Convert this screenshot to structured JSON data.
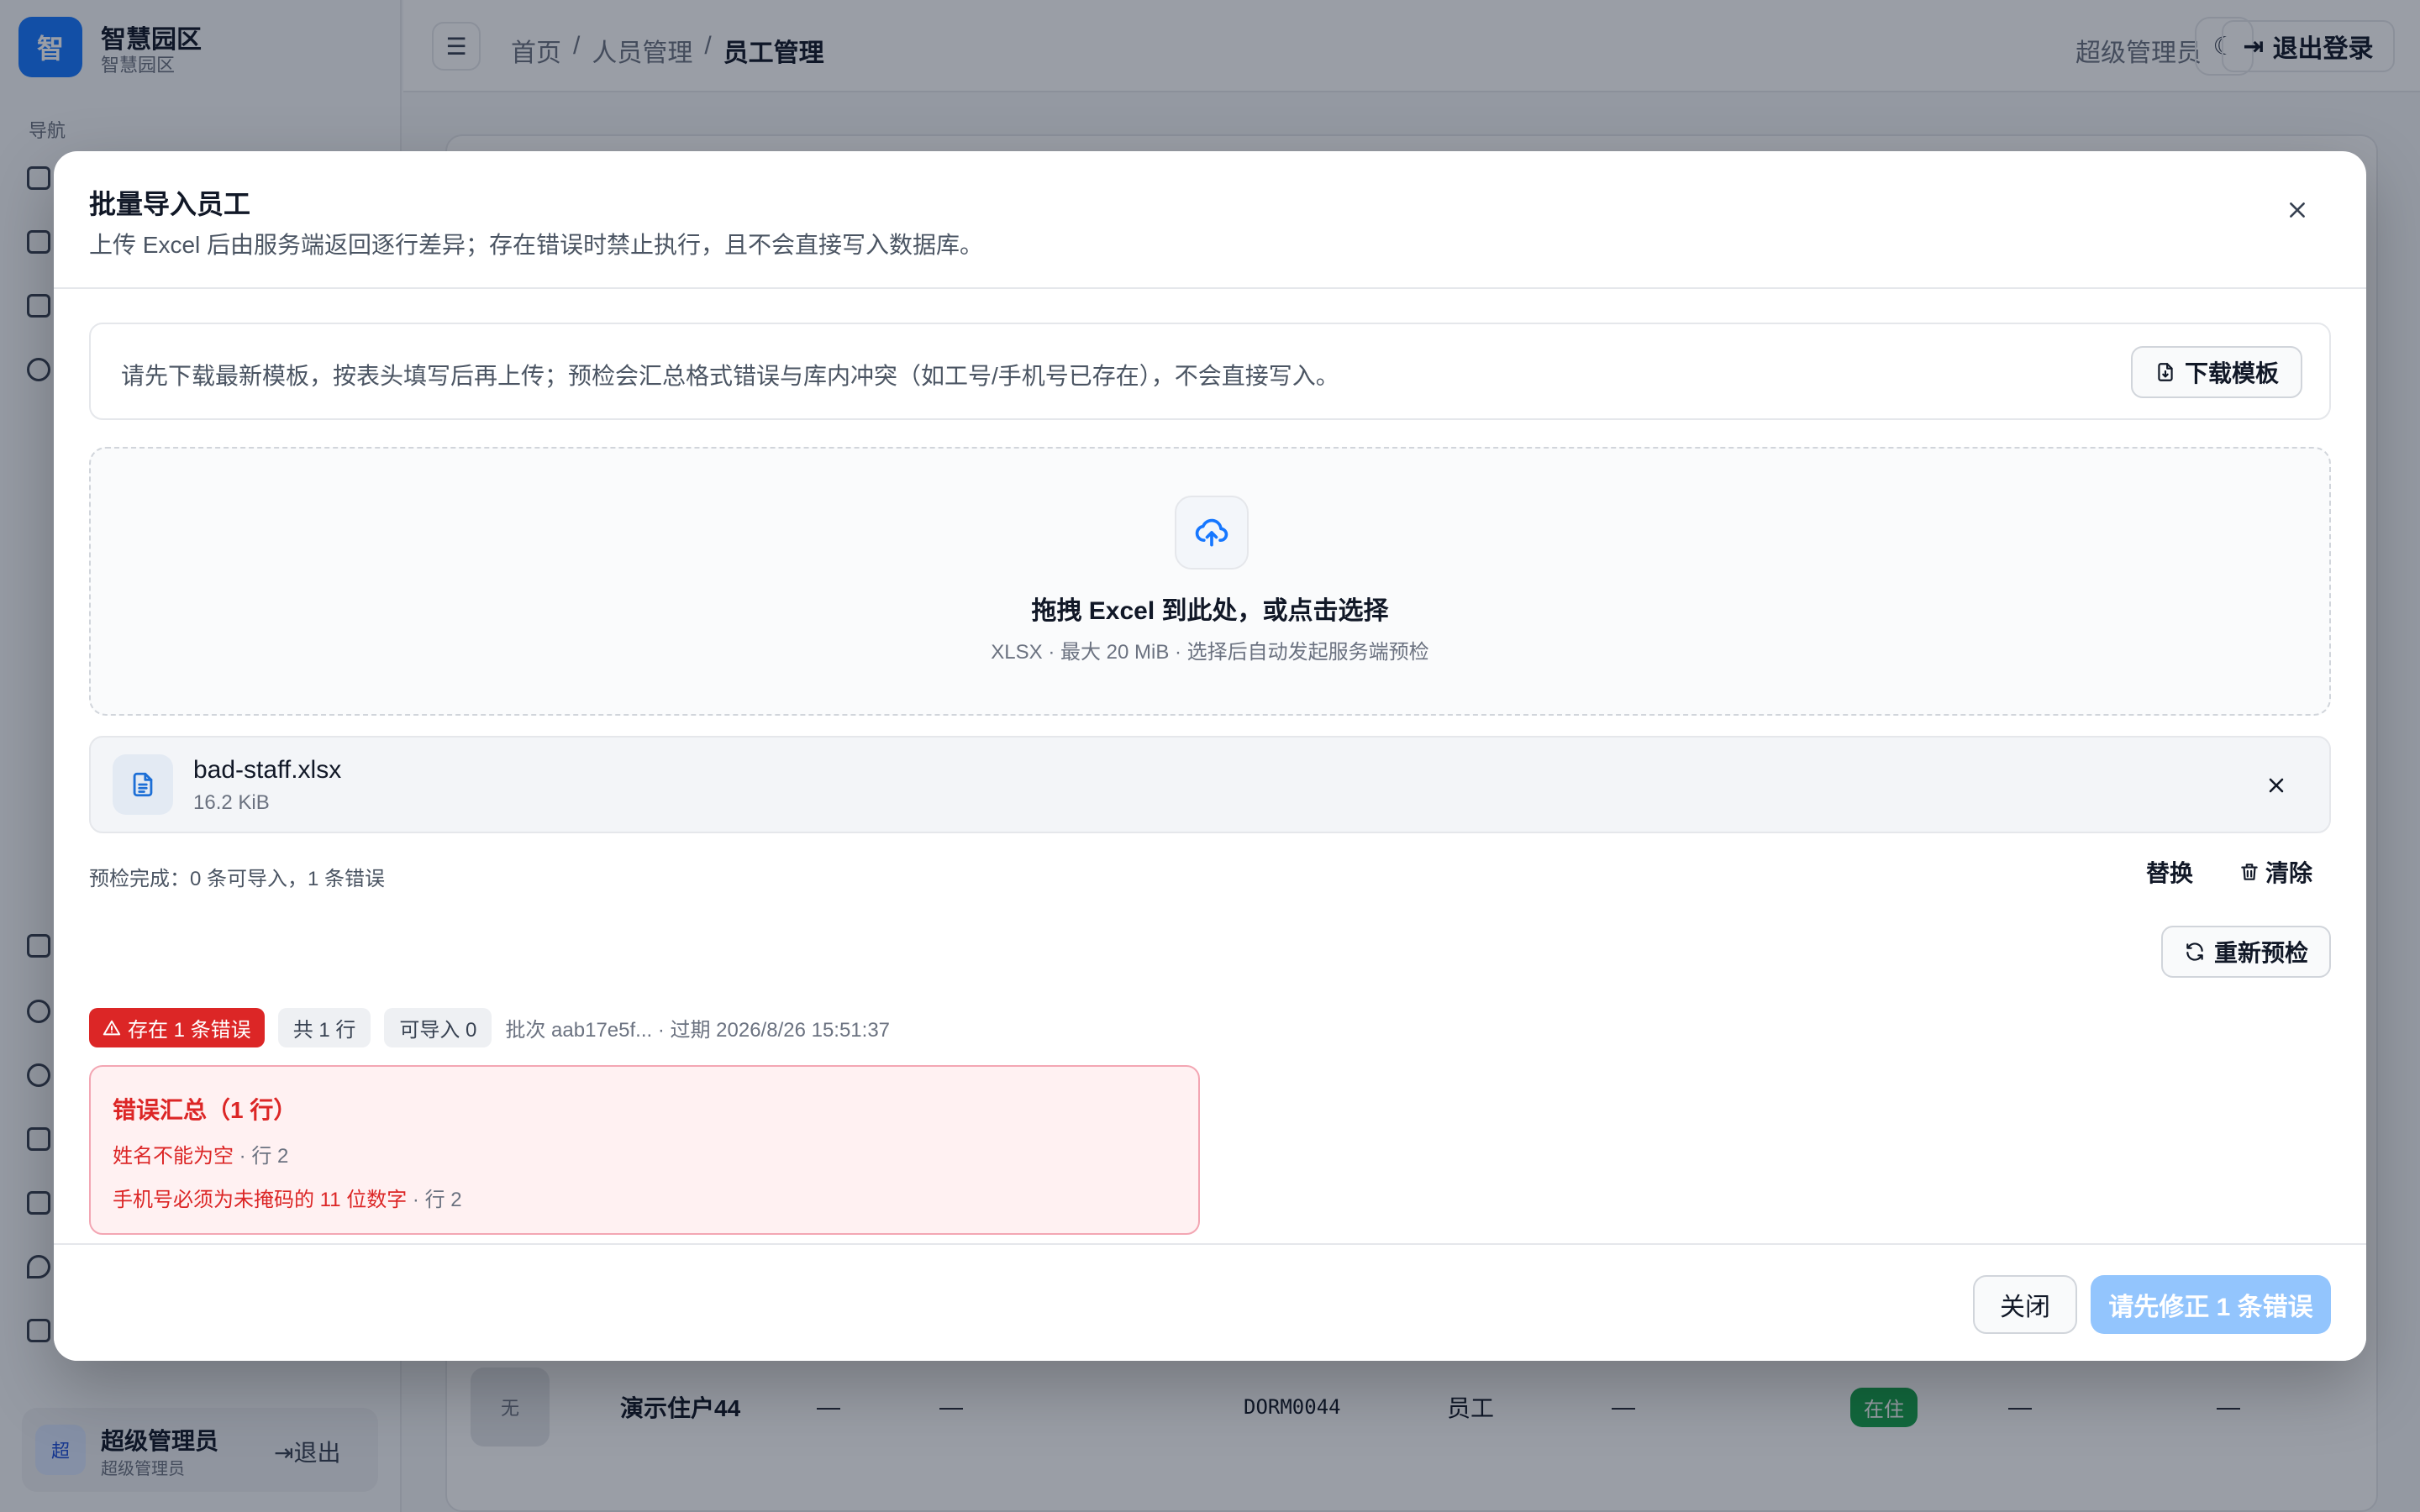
{
  "app": {
    "logo_text": "智",
    "name": "智慧园区",
    "subtitle": "智慧园区"
  },
  "sidebar": {
    "section_label": "导航"
  },
  "sidebar_user": {
    "avatar": "超",
    "name": "超级管理员",
    "role": "超级管理员",
    "logout": "退出"
  },
  "topbar": {
    "breadcrumb": [
      "首页",
      "/",
      "人员管理",
      "/",
      "员工管理"
    ],
    "user": "超级管理员",
    "logout": "退出登录"
  },
  "bg_row": {
    "avatar": "无",
    "name": "演示住户44",
    "c1": "—",
    "c2": "—",
    "code": "DORM0044",
    "type": "员工",
    "c3": "—",
    "status": "在住",
    "c4": "—",
    "c5": "—"
  },
  "modal": {
    "title": "批量导入员工",
    "description": "上传 Excel 后由服务端返回逐行差异；存在错误时禁止执行，且不会直接写入数据库。",
    "tip": "请先下载最新模板，按表头填写后再上传；预检会汇总格式错误与库内冲突（如工号/手机号已存在），不会直接写入。",
    "download_template": "下载模板",
    "dropzone": {
      "title": "拖拽 Excel 到此处，或点击选择",
      "subtitle": "XLSX · 最大 20 MiB · 选择后自动发起服务端预检"
    },
    "file": {
      "name": "bad-staff.xlsx",
      "size": "16.2 KiB"
    },
    "precheck_status": "预检完成：0 条可导入，1 条错误",
    "replace": "替换",
    "clear": "清除",
    "recheck": "重新预检",
    "badges": {
      "error": "存在 1 条错误",
      "total": "共 1 行",
      "importable": "可导入 0",
      "batch": "批次 aab17e5f... · 过期 2026/8/26 15:51:37"
    },
    "error_summary": {
      "title": "错误汇总（1 行）",
      "items": [
        {
          "message": "姓名不能为空",
          "row": " · 行 2"
        },
        {
          "message": "手机号必须为未掩码的 11 位数字",
          "row": " · 行 2"
        }
      ]
    },
    "footer": {
      "close": "关闭",
      "submit": "请先修正 1 条错误"
    }
  },
  "colors": {
    "primary": "#1677ff",
    "danger": "#dc2626",
    "disabled_primary": "#93c5fd"
  }
}
